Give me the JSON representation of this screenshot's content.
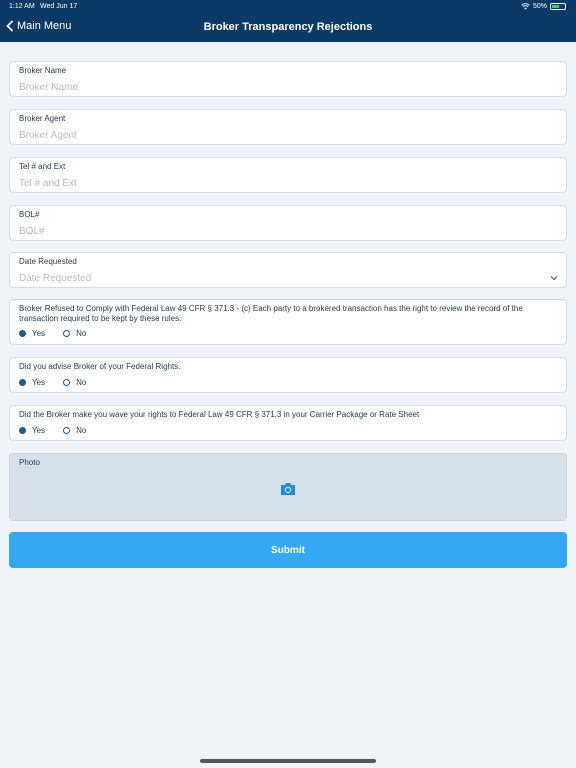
{
  "status": {
    "time": "1:12 AM",
    "date": "Wed Jun 17",
    "battery": "50%"
  },
  "nav": {
    "back_label": "Main Menu",
    "title": "Broker Transparency Rejections"
  },
  "fields": [
    {
      "label": "Broker Name",
      "placeholder": "Broker Name"
    },
    {
      "label": "Broker Agent",
      "placeholder": "Broker Agent"
    },
    {
      "label": "Tel # and Ext",
      "placeholder": "Tel # and Ext"
    },
    {
      "label": "BOL#",
      "placeholder": "BOL#"
    }
  ],
  "date_field": {
    "label": "Date Requested",
    "placeholder": "Date Requested"
  },
  "questions": [
    {
      "text": "Broker Refused to Comply with Federal Law 49 CFR § 371.3 - (c) Each party to a brokered transaction has the right to review the record of the transaction required to be kept by these rules.",
      "yes": "Yes",
      "no": "No",
      "selected": "Yes"
    },
    {
      "text": "Did you advise Broker of your Federal Rights.",
      "yes": "Yes",
      "no": "No",
      "selected": "Yes"
    },
    {
      "text": "Did the Broker make you wave your rights to  Federal Law 49 CFR § 371.3 in your Carrier Package or Rate Sheet",
      "yes": "Yes",
      "no": "No",
      "selected": "Yes"
    }
  ],
  "photo": {
    "label": "Photo",
    "icon": "camera-icon"
  },
  "submit_label": "Submit",
  "colors": {
    "header": "#0b3a66",
    "accent": "#35a8f5",
    "radio": "#1e5a8a"
  }
}
